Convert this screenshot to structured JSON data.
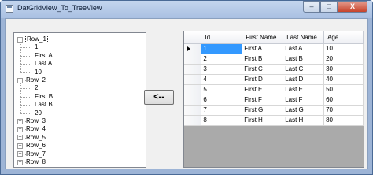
{
  "window": {
    "title": "DatGridView_To_TreeView",
    "minimize_glyph": "–",
    "maximize_glyph": "□",
    "close_glyph": "X",
    "colors": {
      "frame": "#9db4d6",
      "close": "#c7432b",
      "selection": "#3399ff",
      "grid_bg": "#aaaaaa"
    }
  },
  "tree": {
    "expand_glyph": "+",
    "collapse_glyph": "−",
    "nodes": [
      {
        "label": "Row_1",
        "expanded": true,
        "selected": true,
        "children": [
          "1",
          "First A",
          "Last A",
          "10"
        ]
      },
      {
        "label": "Row_2",
        "expanded": true,
        "selected": false,
        "children": [
          "2",
          "First B",
          "Last B",
          "20"
        ]
      },
      {
        "label": "Row_3",
        "expanded": false
      },
      {
        "label": "Row_4",
        "expanded": false
      },
      {
        "label": "Row_5",
        "expanded": false
      },
      {
        "label": "Row_6",
        "expanded": false
      },
      {
        "label": "Row_7",
        "expanded": false
      },
      {
        "label": "Row_8",
        "expanded": false
      }
    ]
  },
  "transfer_button": {
    "label": "<--"
  },
  "grid": {
    "columns": [
      "Id",
      "First Name",
      "Last Name",
      "Age"
    ],
    "current_row_indicator": "right-triangle-icon",
    "rows": [
      [
        "1",
        "First A",
        "Last A",
        "10"
      ],
      [
        "2",
        "First B",
        "Last B",
        "20"
      ],
      [
        "3",
        "First C",
        "Last C",
        "30"
      ],
      [
        "4",
        "First D",
        "Last D",
        "40"
      ],
      [
        "5",
        "First E",
        "Last E",
        "50"
      ],
      [
        "6",
        "First F",
        "Last F",
        "60"
      ],
      [
        "7",
        "First G",
        "Last G",
        "70"
      ],
      [
        "8",
        "First H",
        "Last H",
        "80"
      ]
    ]
  }
}
